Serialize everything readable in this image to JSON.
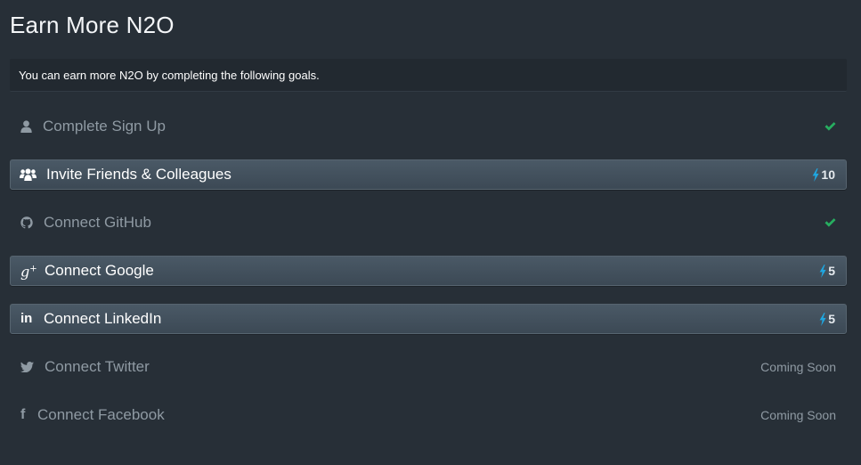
{
  "page": {
    "title": "Earn More N2O",
    "intro": "You can earn more N2O by completing the following goals."
  },
  "colors": {
    "background": "#272f37",
    "completed_check": "#27ae60",
    "bolt": "#1fa7e1",
    "muted_text": "#8f9aa3"
  },
  "goals": [
    {
      "label": "Complete Sign Up",
      "icon": "user-icon",
      "state": "completed",
      "status_icon": "check-icon"
    },
    {
      "label": "Invite Friends & Colleagues",
      "icon": "group-icon",
      "state": "available",
      "status_icon": "bolt-icon",
      "points": "10"
    },
    {
      "label": "Connect GitHub",
      "icon": "github-icon",
      "state": "completed",
      "status_icon": "check-icon"
    },
    {
      "label": "Connect Google",
      "icon": "google-plus-icon",
      "state": "available",
      "status_icon": "bolt-icon",
      "points": "5"
    },
    {
      "label": "Connect LinkedIn",
      "icon": "linkedin-icon",
      "state": "available",
      "status_icon": "bolt-icon",
      "points": "5"
    },
    {
      "label": "Connect Twitter",
      "icon": "twitter-icon",
      "state": "coming-soon",
      "status_text": "Coming Soon"
    },
    {
      "label": "Connect Facebook",
      "icon": "facebook-icon",
      "state": "coming-soon",
      "status_text": "Coming Soon"
    }
  ]
}
